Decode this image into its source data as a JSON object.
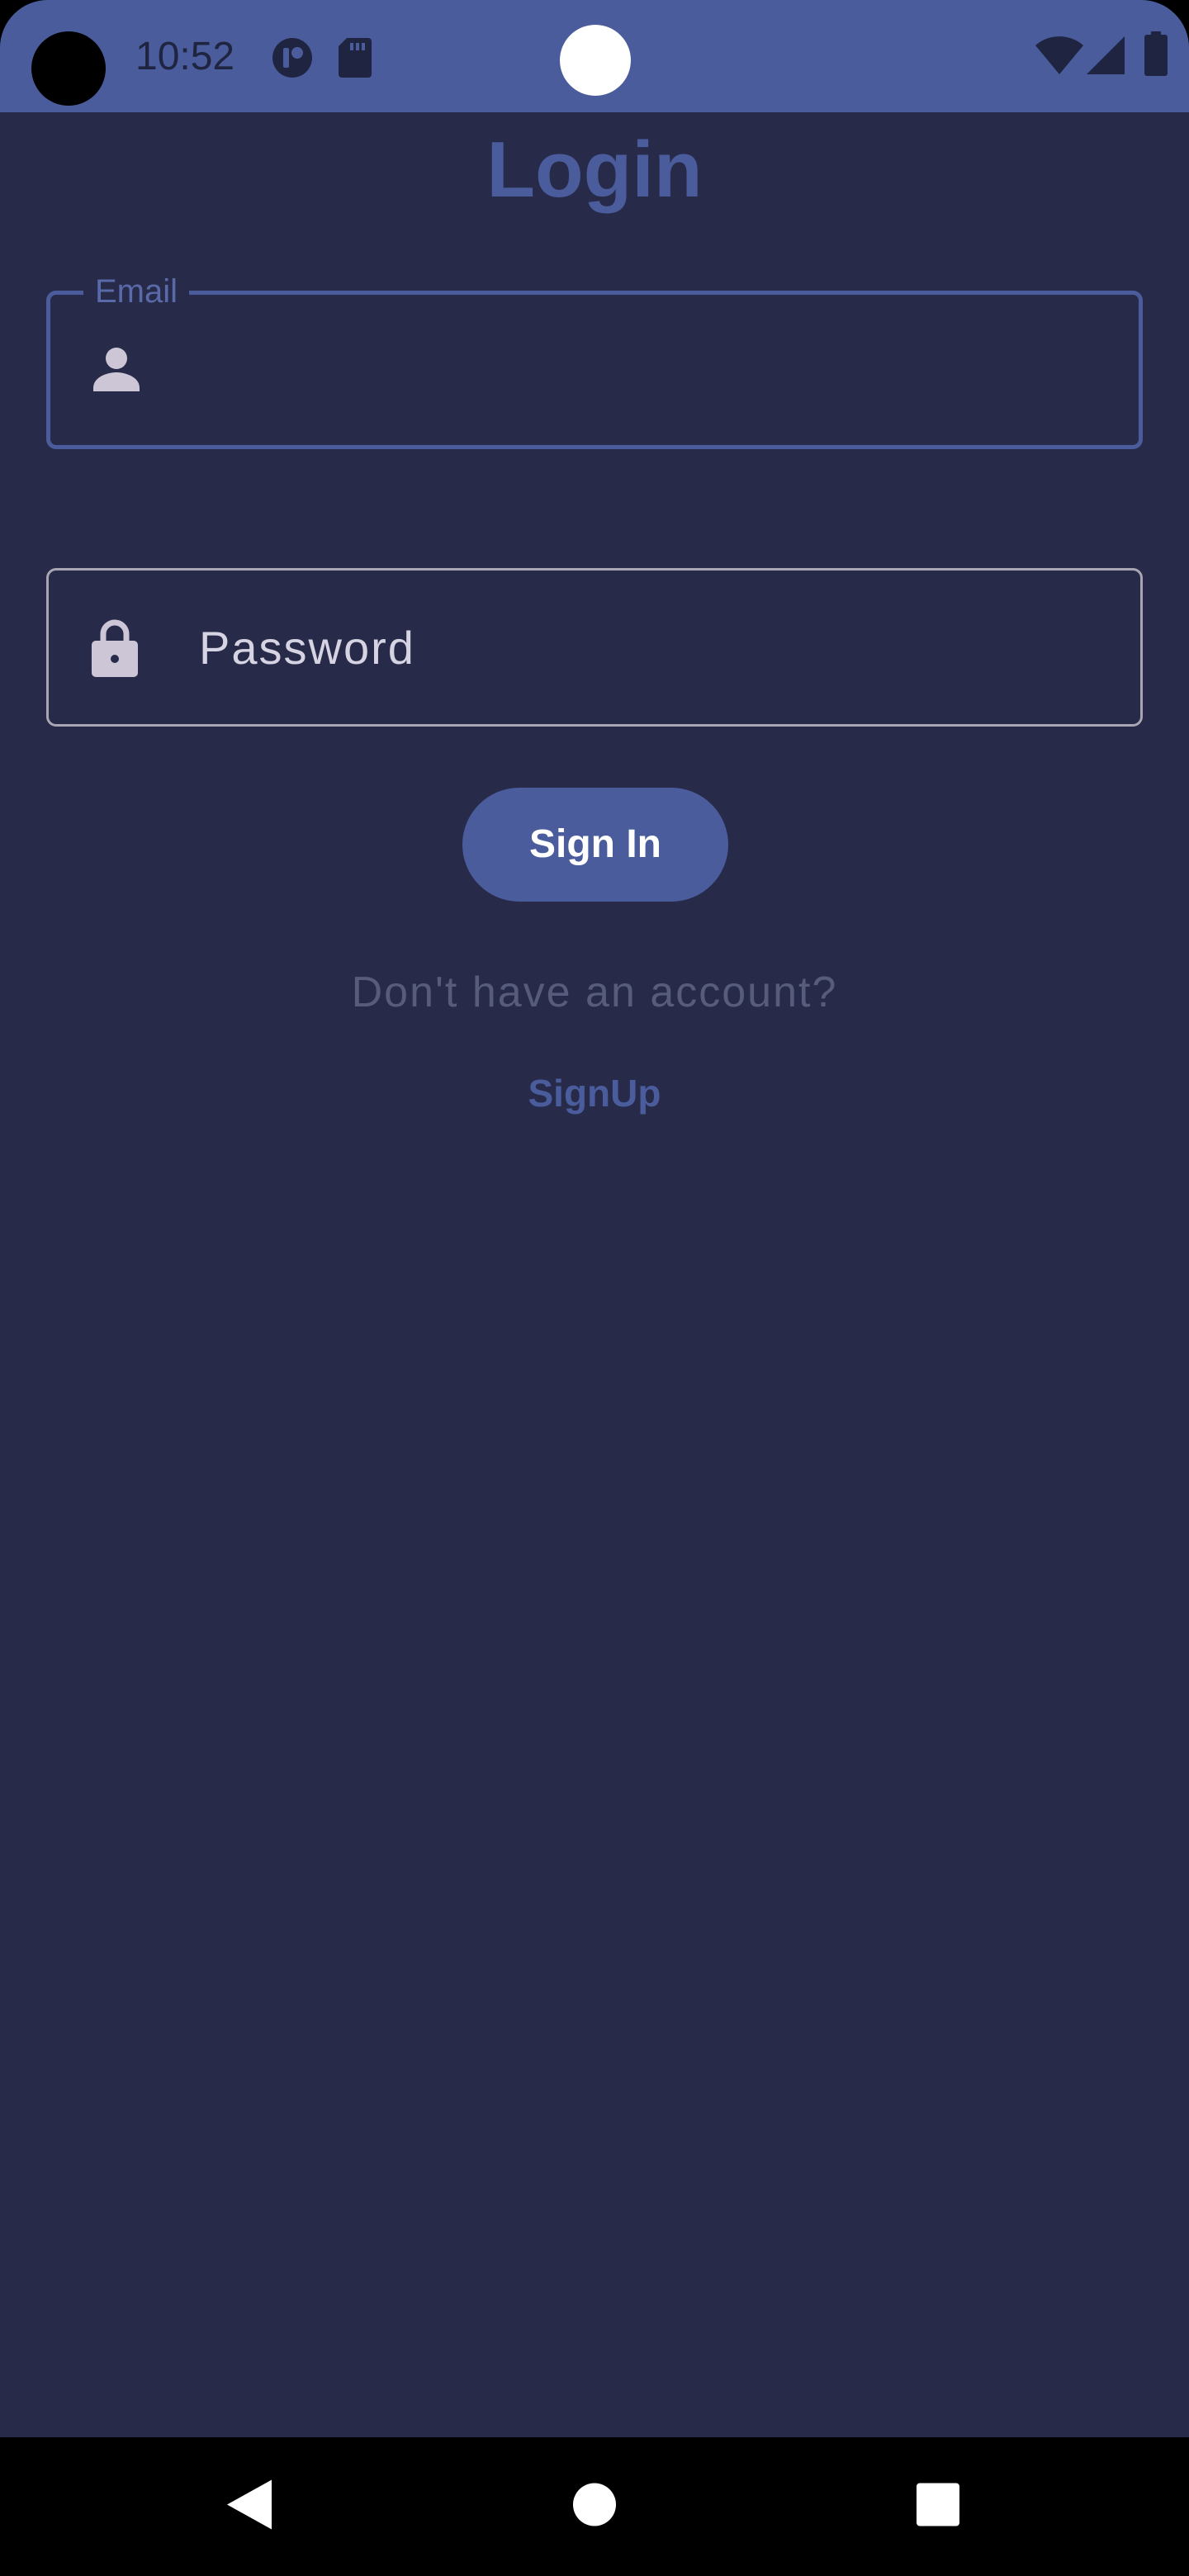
{
  "status_bar": {
    "time": "10:52",
    "background_color": "#4a5c9c",
    "left_icons": [
      "camera-cutout-icon",
      "app-notification-icon",
      "sd-card-icon"
    ],
    "right_icons": [
      "wifi-icon",
      "cell-signal-icon",
      "battery-icon"
    ]
  },
  "screen": {
    "title": "Login",
    "accent_color": "#4a5c9c",
    "background_color": "#272b49"
  },
  "email_field": {
    "label": "Email",
    "value": "",
    "icon": "person-icon",
    "focused": true
  },
  "password_field": {
    "placeholder": "Password",
    "value": "",
    "icon": "lock-icon"
  },
  "sign_in_button": {
    "label": "Sign In"
  },
  "no_account_text": "Don't have an account?",
  "signup_link": {
    "label": "SignUp"
  },
  "nav_bar": {
    "buttons": [
      "back-icon",
      "home-icon",
      "recents-icon"
    ]
  }
}
